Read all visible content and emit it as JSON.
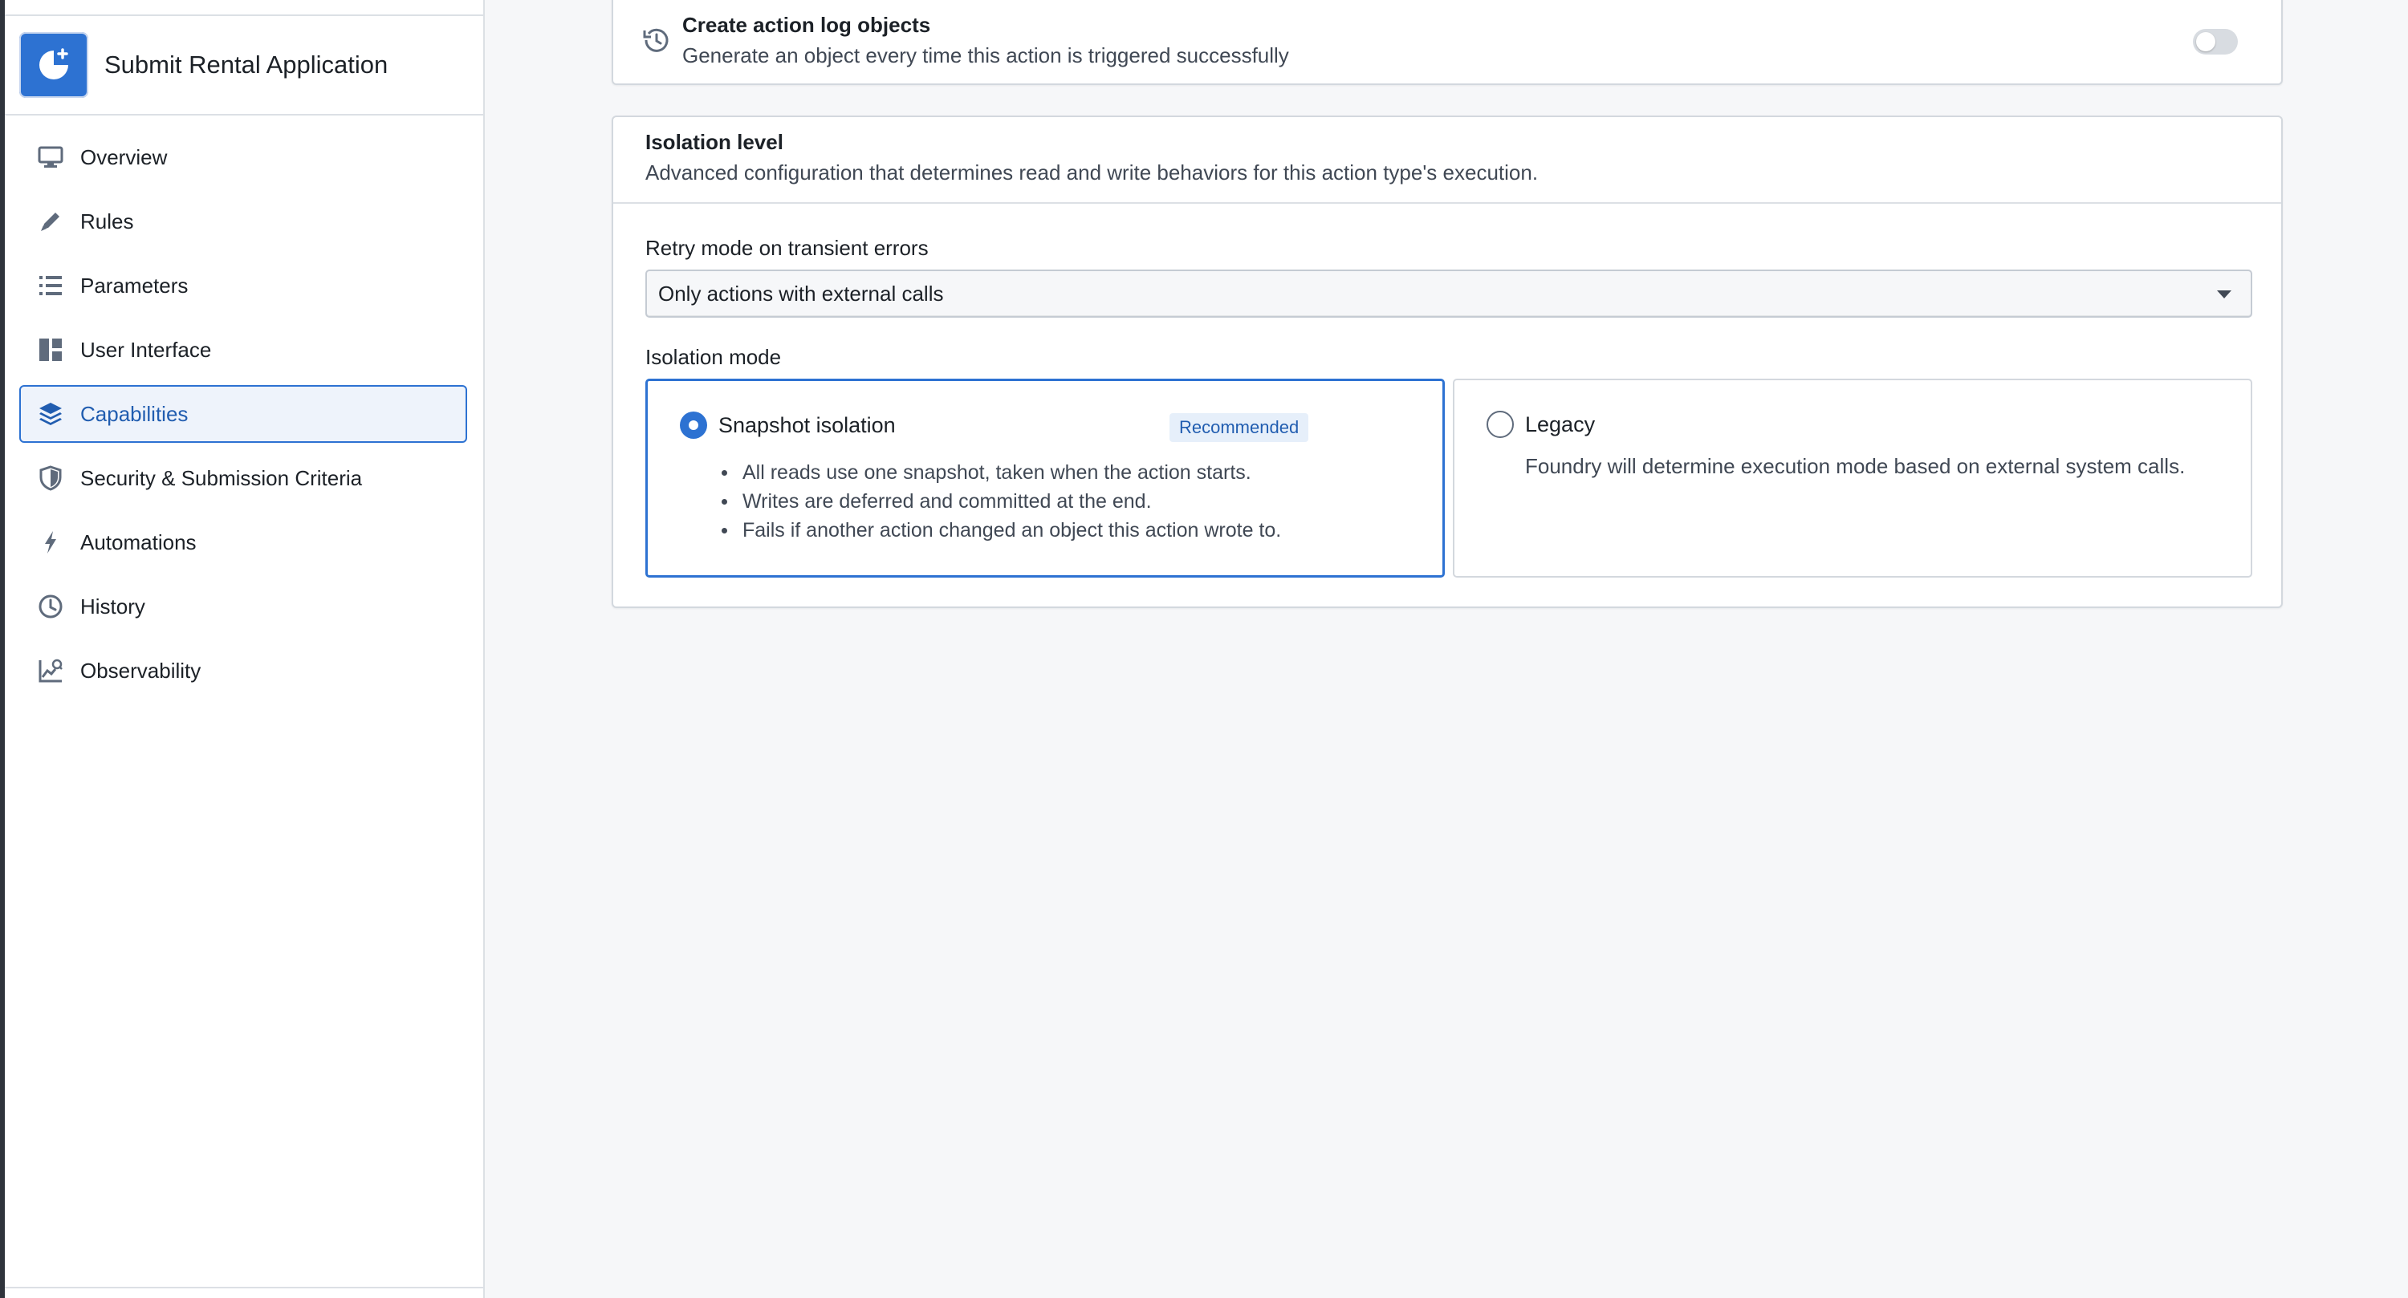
{
  "app": {
    "title": "Submit Rental Application",
    "logo_icon": "action-type-icon",
    "accent_color": "#2d72d2"
  },
  "sidebar": {
    "items": [
      {
        "label": "Overview",
        "icon": "desktop-icon"
      },
      {
        "label": "Rules",
        "icon": "edit-icon"
      },
      {
        "label": "Parameters",
        "icon": "properties-icon"
      },
      {
        "label": "User Interface",
        "icon": "layout-icon"
      },
      {
        "label": "Capabilities",
        "icon": "layers-icon",
        "active": true
      },
      {
        "label": "Security & Submission Criteria",
        "icon": "shield-icon"
      },
      {
        "label": "Automations",
        "icon": "lightning-icon"
      },
      {
        "label": "History",
        "icon": "history-icon"
      },
      {
        "label": "Observability",
        "icon": "chart-search-icon"
      }
    ]
  },
  "action_log": {
    "title": "Create action log objects",
    "subtitle": "Generate an object every time this action is triggered successfully",
    "enabled": false
  },
  "isolation": {
    "title": "Isolation level",
    "subtitle": "Advanced configuration that determines read and write behaviors for this action type's execution.",
    "retry_label": "Retry mode on transient errors",
    "retry_value": "Only actions with external calls",
    "mode_label": "Isolation mode",
    "options": [
      {
        "title": "Snapshot isolation",
        "badge": "Recommended",
        "selected": true,
        "bullets": [
          "All reads use one snapshot, taken when the action starts.",
          "Writes are deferred and committed at the end.",
          "Fails if another action changed an object this action wrote to."
        ]
      },
      {
        "title": "Legacy",
        "selected": false,
        "description": "Foundry will determine execution mode based on external system calls."
      }
    ]
  }
}
